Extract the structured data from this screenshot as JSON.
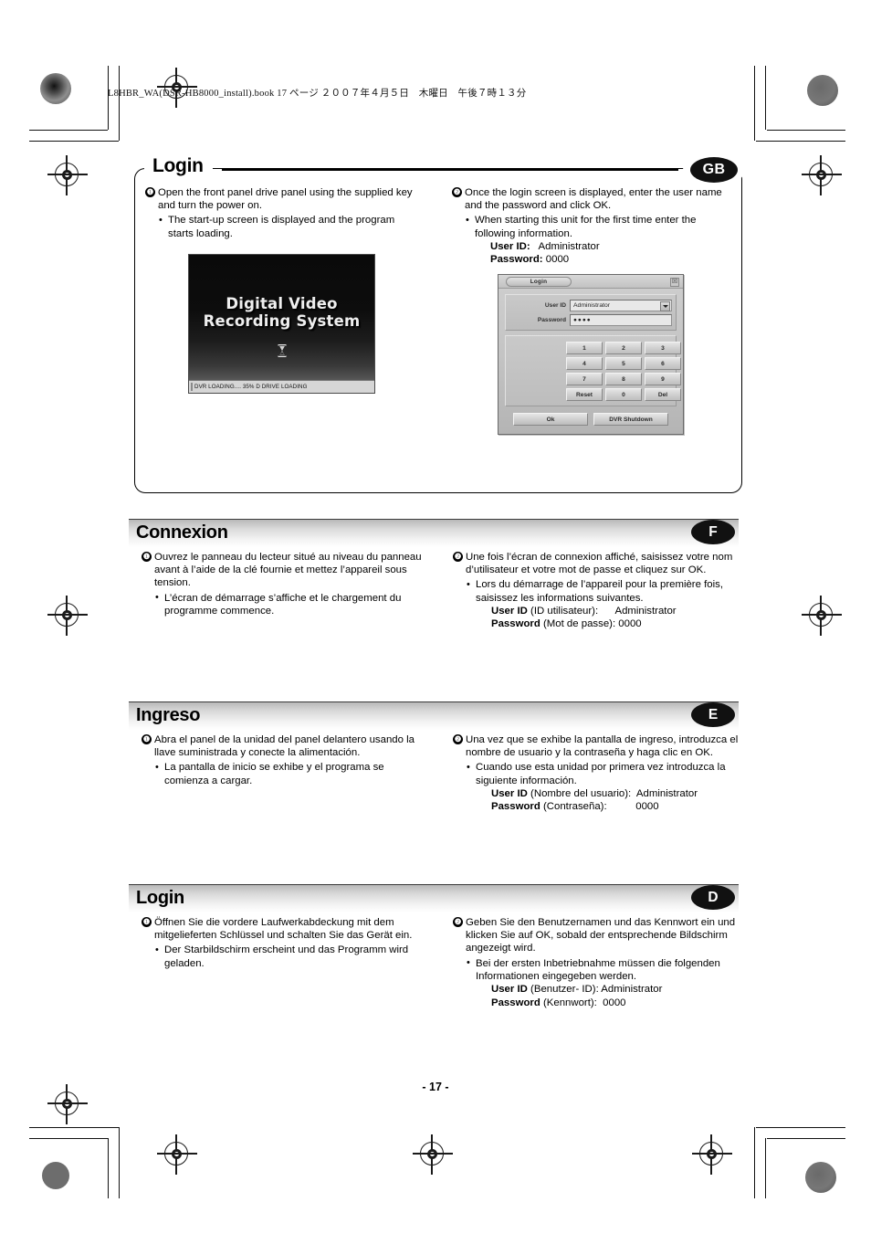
{
  "running_header": "L8HBR_WA(DSR-HB8000_install).book  17 ページ  ２００７年４月５日　木曜日　午後７時１３分",
  "page_number": "- 17 -",
  "sections": [
    {
      "id": "gb",
      "title": "Login",
      "badge": "GB",
      "left": {
        "step_num": "❶",
        "step_text": "Open the front panel drive panel using the supplied key and turn the power on.",
        "bullet_text": "The start-up screen is displayed and the program starts loading."
      },
      "right": {
        "step_num": "❷",
        "step_text": "Once the login screen is displayed, enter the user name and the password and click OK.",
        "bullet_text": "When starting this unit for the first time enter the following information.",
        "kv": [
          {
            "key": "User ID:",
            "value": "   Administrator"
          },
          {
            "key": "Password:",
            "value": " 0000"
          }
        ]
      }
    },
    {
      "id": "f",
      "title": "Connexion",
      "badge": "F",
      "left": {
        "step_num": "❶",
        "step_text": "Ouvrez le panneau du lecteur situé au niveau du panneau avant à l’aide de la clé fournie et mettez l’appareil sous tension.",
        "bullet_text": "L’écran de démarrage s’affiche et le chargement du programme commence."
      },
      "right": {
        "step_num": "❷",
        "step_text": "Une fois l’écran de connexion affiché, saisissez votre nom d’utilisateur et votre mot de passe et cliquez sur OK.",
        "bullet_text": "Lors du démarrage de l’appareil pour la première fois, saisissez les informations suivantes.",
        "kv": [
          {
            "key": "User ID",
            "value": " (ID utilisateur):      Administrator"
          },
          {
            "key": "Password",
            "value": " (Mot de passe): 0000"
          }
        ]
      }
    },
    {
      "id": "e",
      "title": "Ingreso",
      "badge": "E",
      "left": {
        "step_num": "❶",
        "step_text": "Abra el panel de la unidad del panel delantero usando la llave suministrada y conecte la alimentación.",
        "bullet_text": "La pantalla de inicio se exhibe y el programa se comienza a cargar."
      },
      "right": {
        "step_num": "❷",
        "step_text": "Una vez que se exhibe la pantalla de ingreso, introduzca el nombre de usuario y la contraseña y haga clic en OK.",
        "bullet_text": "Cuando use esta unidad por primera vez introduzca la siguiente información.",
        "kv": [
          {
            "key": "User ID",
            "value": " (Nombre del usuario):  Administrator"
          },
          {
            "key": "Password",
            "value": " (Contraseña):          0000"
          }
        ]
      }
    },
    {
      "id": "d",
      "title": "Login",
      "badge": "D",
      "left": {
        "step_num": "❶",
        "step_text": "Öffnen Sie die vordere Laufwerkabdeckung mit dem mitgelieferten Schlüssel und schalten Sie das Gerät ein.",
        "bullet_text": "Der Starbildschirm erscheint und das Programm wird geladen."
      },
      "right": {
        "step_num": "❷",
        "step_text": "Geben Sie den Benutzernamen und das Kennwort ein und klicken Sie auf OK, sobald der entsprechende Bildschirm angezeigt wird.",
        "bullet_text": "Bei der ersten Inbetriebnahme müssen die folgenden Informationen eingegeben werden.",
        "kv": [
          {
            "key": "User ID",
            "value": " (Benutzer- ID): Administrator"
          },
          {
            "key": "Password",
            "value": " (Kennwort):  0000"
          }
        ]
      }
    }
  ],
  "splash_screenshot": {
    "line1": "Digital Video",
    "line2": "Recording System",
    "cursor_icon": "hourglass-icon",
    "status_text": "DVR LOADING.... 35% D DRIVE LOADING",
    "progress_percent": "35%"
  },
  "login_dialog": {
    "title": "Login",
    "close_label": "☒",
    "user_id_label": "User ID",
    "user_id_value": "Administrator",
    "password_label": "Password",
    "password_value": "●●●●",
    "keypad": [
      "1",
      "2",
      "3",
      "4",
      "5",
      "6",
      "7",
      "8",
      "9",
      "Reset",
      "0",
      "Del"
    ],
    "ok_label": "Ok",
    "shutdown_label": "DVR Shutdown"
  }
}
